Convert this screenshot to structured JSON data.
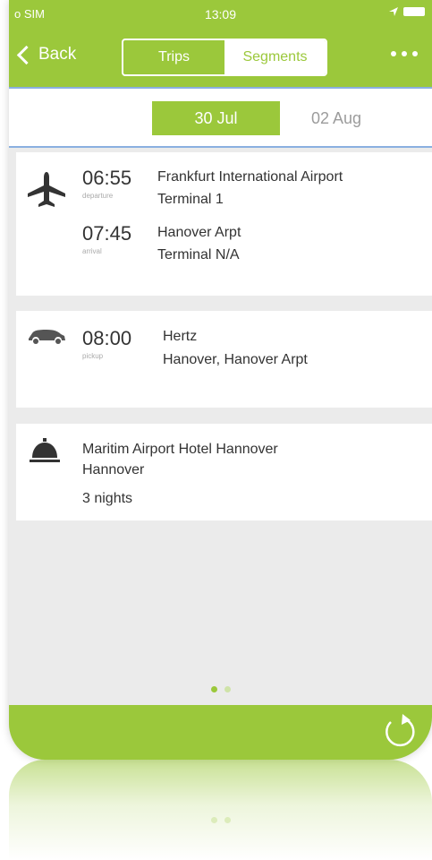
{
  "status_bar": {
    "carrier": "o SIM",
    "time": "13:09"
  },
  "nav": {
    "back_label": "Back",
    "tabs": [
      {
        "label": "Trips",
        "selected": false
      },
      {
        "label": "Segments",
        "selected": true
      }
    ]
  },
  "dates": {
    "active": "30 Jul",
    "next": "02 Aug"
  },
  "segments": {
    "flight": {
      "icon": "airplane-icon",
      "departure": {
        "time": "06:55",
        "label": "departure",
        "place": "Frankfurt International Airport",
        "detail": "Terminal 1"
      },
      "arrival": {
        "time": "07:45",
        "label": "arrival",
        "place": "Hanover Arpt",
        "detail": "Terminal N/A"
      }
    },
    "car": {
      "icon": "car-icon",
      "pickup": {
        "time": "08:00",
        "label": "pickup",
        "company": "Hertz",
        "location": "Hanover, Hanover Arpt"
      }
    },
    "hotel": {
      "icon": "hotel-bell-icon",
      "name": "Maritim Airport Hotel Hannover",
      "city": "Hannover",
      "nights": "3 nights"
    }
  },
  "pager": {
    "pages": 2,
    "current": 1
  },
  "colors": {
    "accent": "#9bc83b",
    "card": "#ffffff",
    "background": "#ebebeb",
    "divider": "#8ab0e0"
  }
}
